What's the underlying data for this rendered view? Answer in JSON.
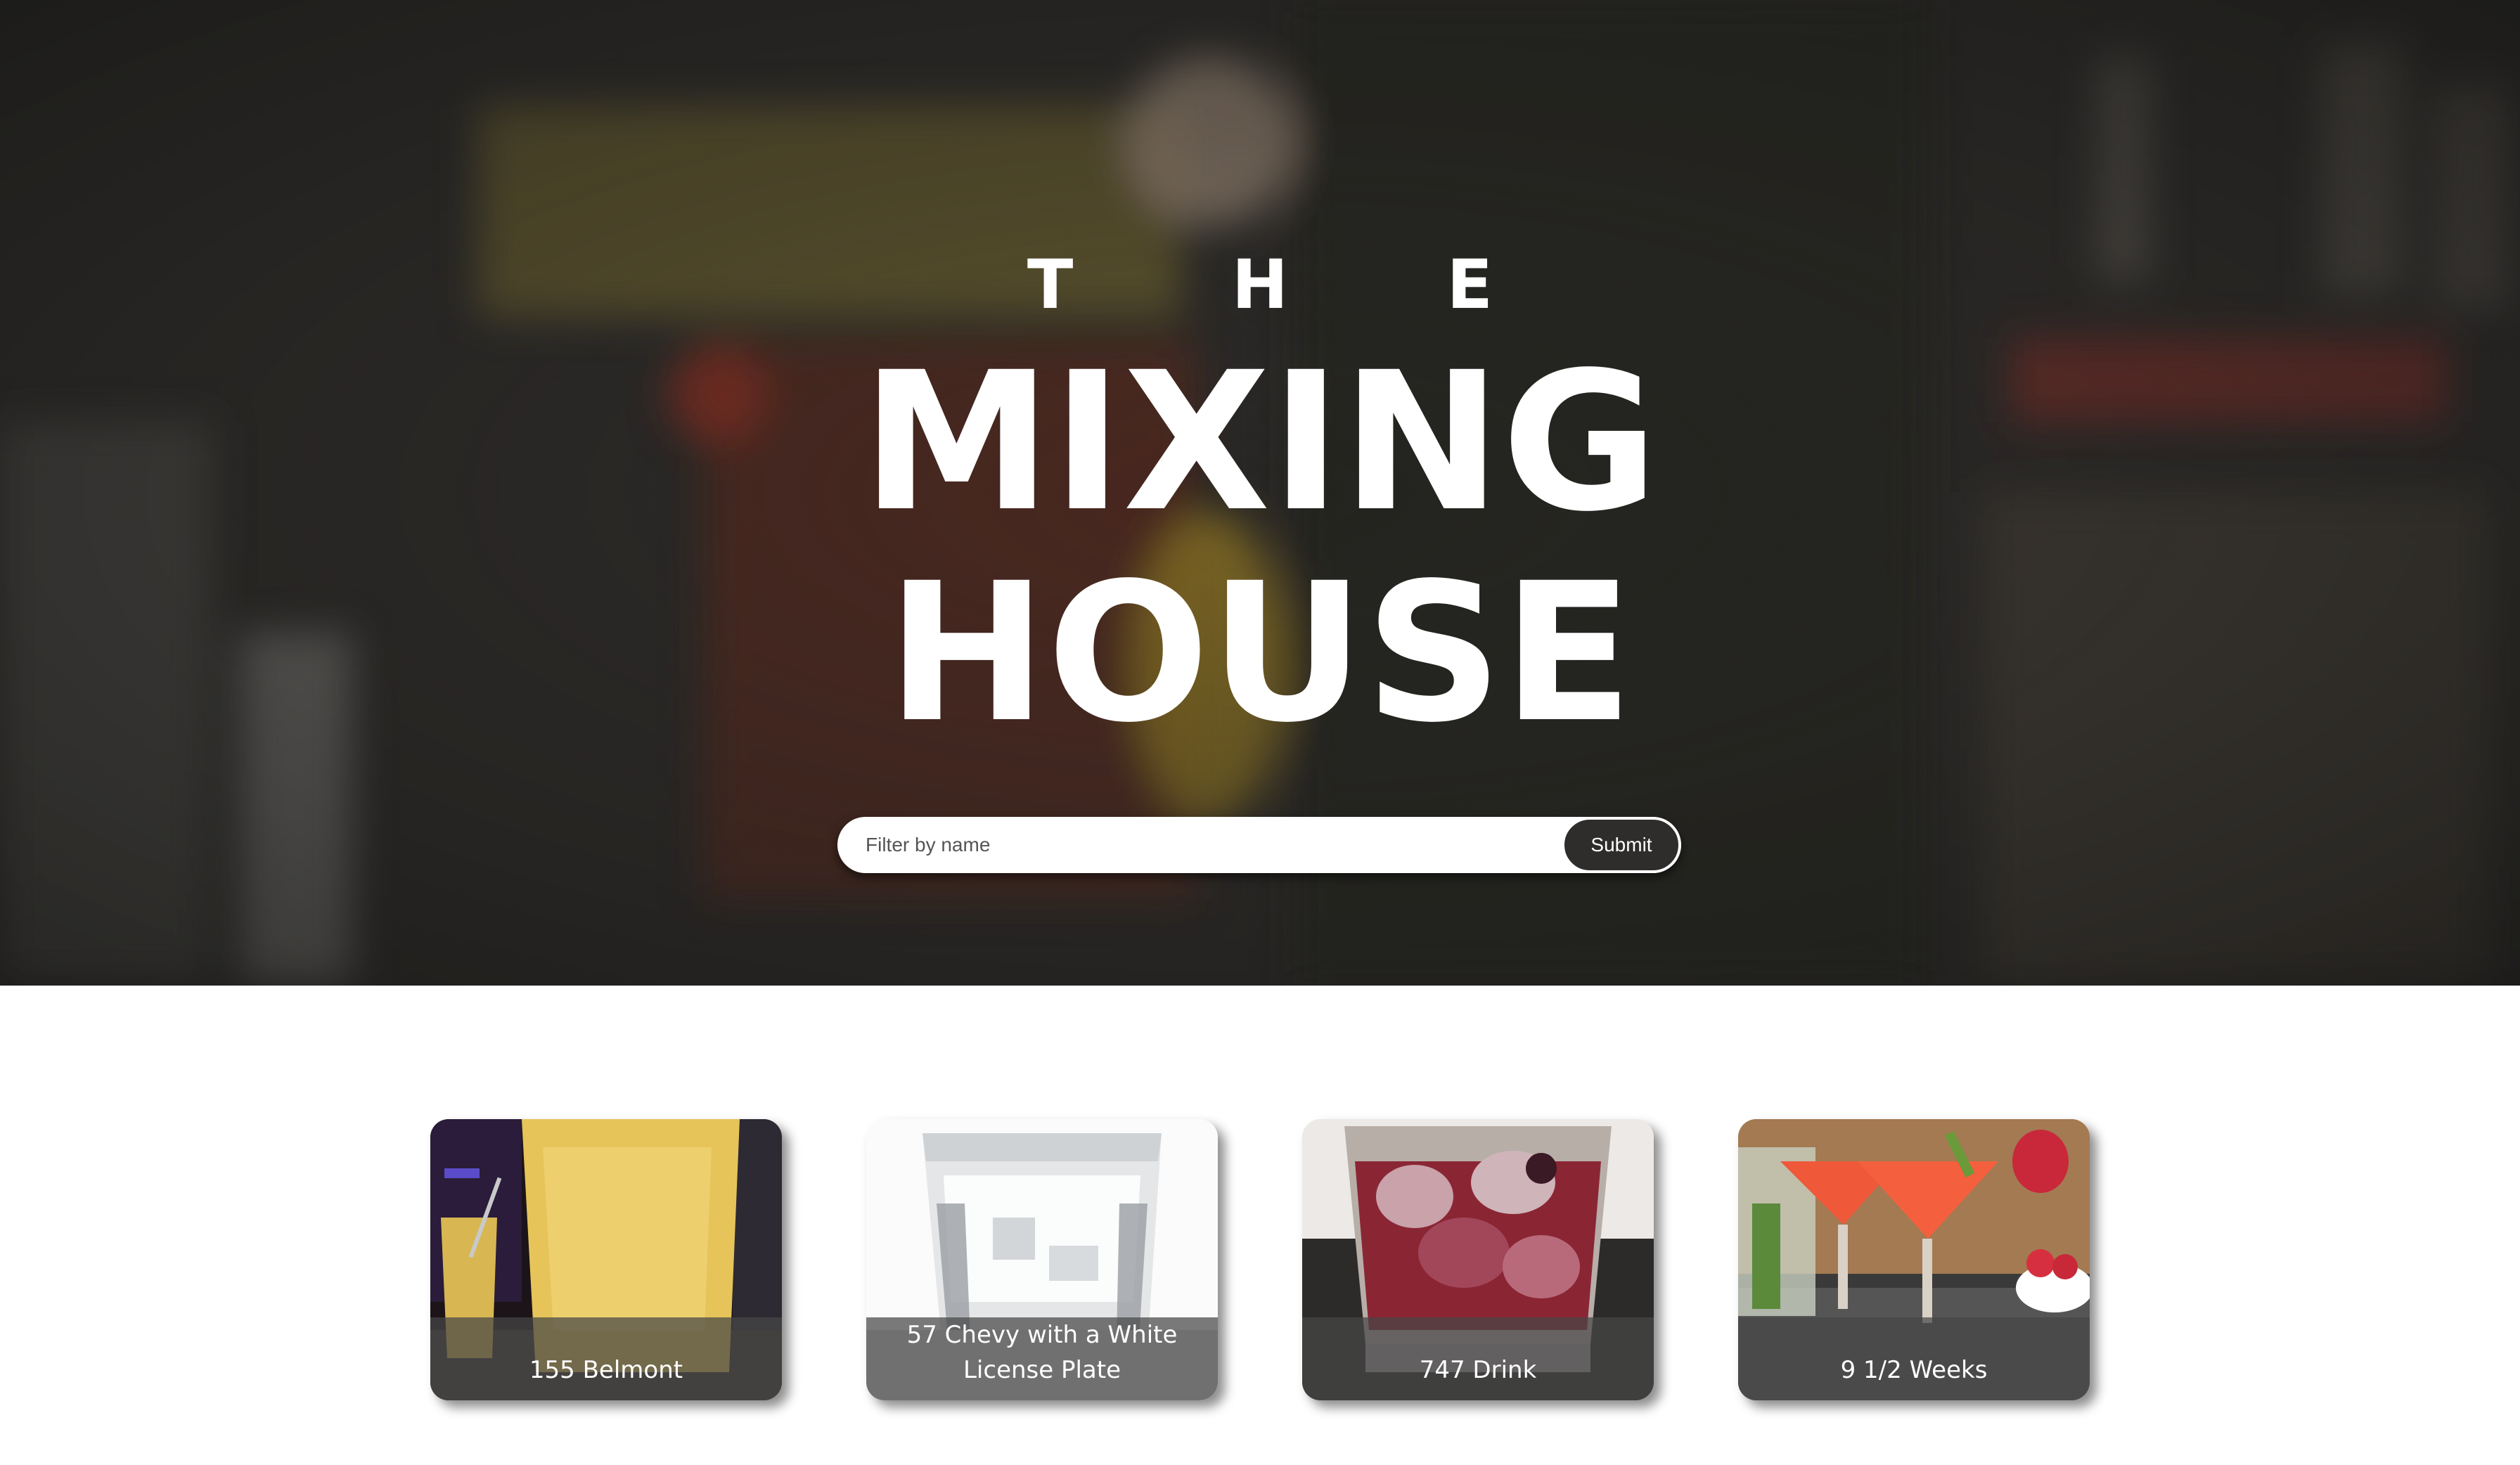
{
  "hero": {
    "title_top": "T H E",
    "title_line1": "MIXING",
    "title_line2": "HOUSE"
  },
  "search": {
    "placeholder": "Filter by name",
    "value": "",
    "submit_label": "Submit"
  },
  "drinks": [
    {
      "name": "155 Belmont"
    },
    {
      "name": "57 Chevy with a White License Plate"
    },
    {
      "name": "747 Drink"
    },
    {
      "name": "9 1/2 Weeks"
    }
  ]
}
